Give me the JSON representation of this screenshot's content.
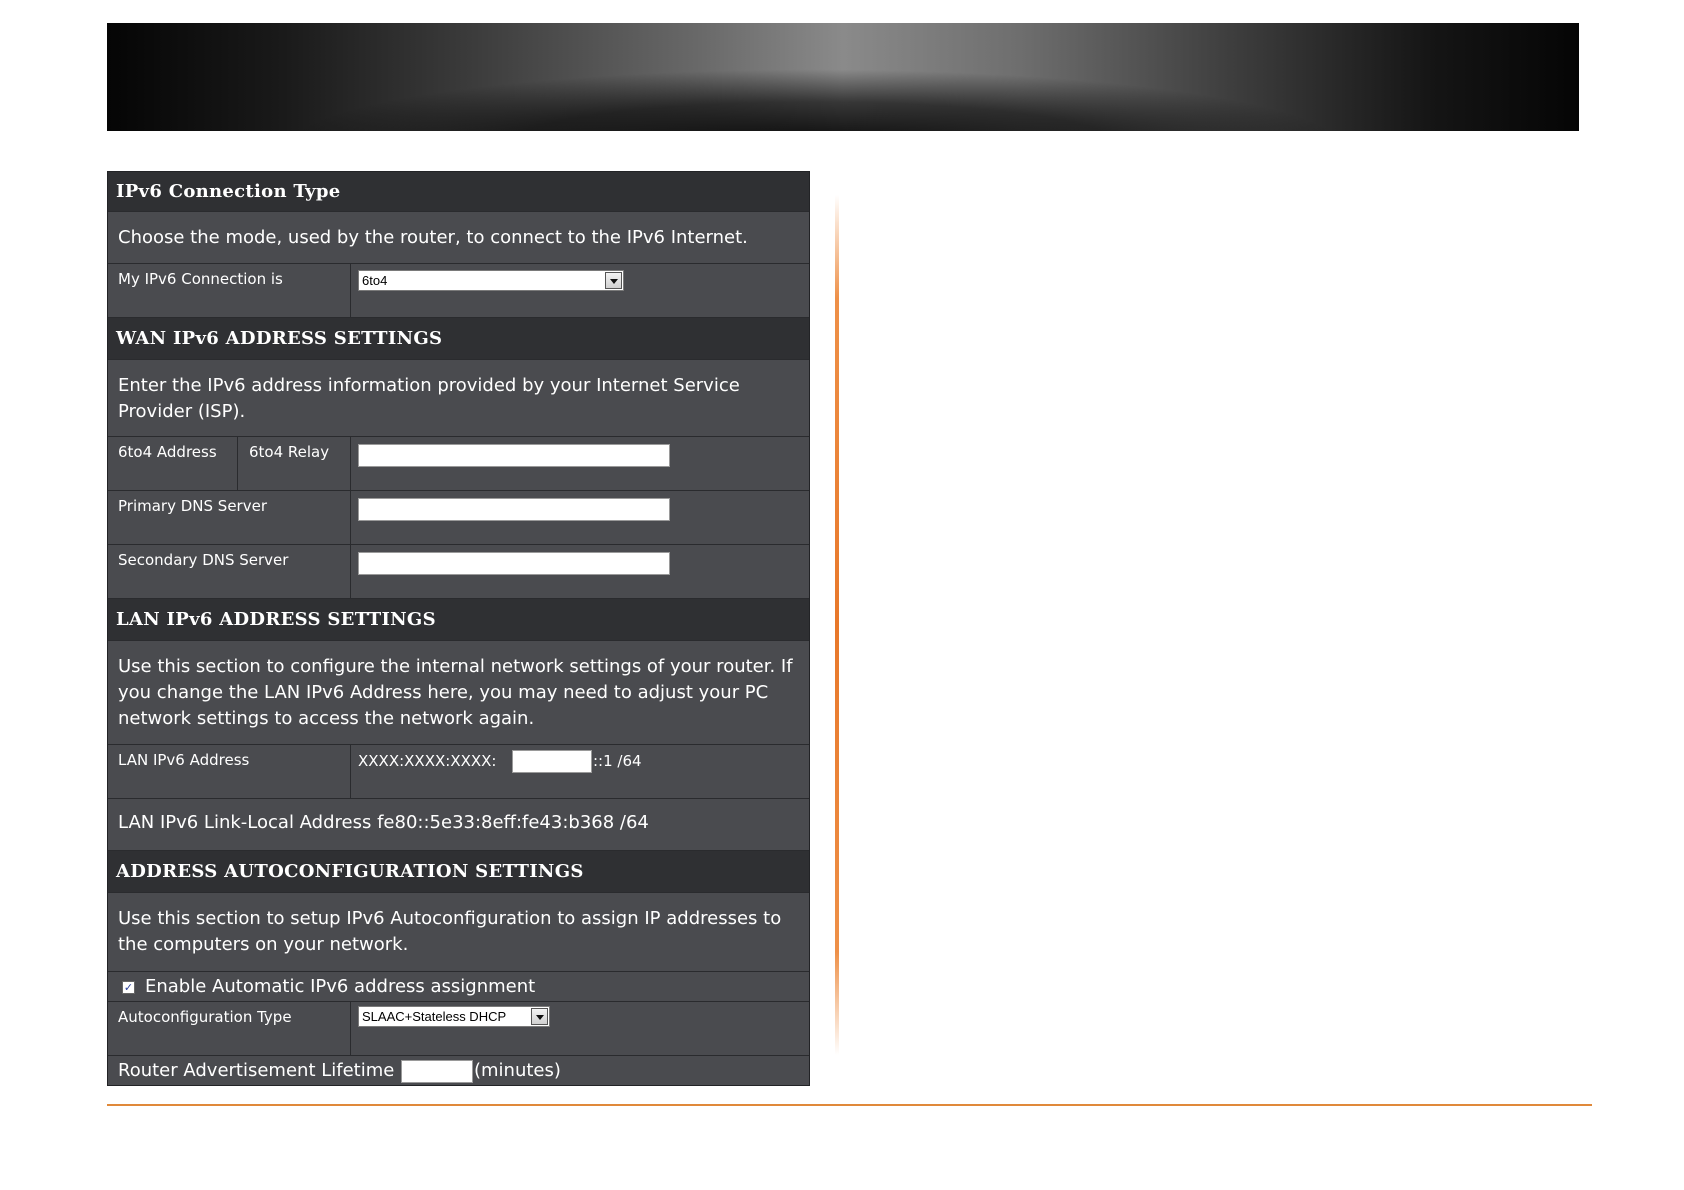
{
  "connection_type": {
    "title": "IPv6 Connection Type",
    "description": "Choose the mode, used by the router, to connect to the IPv6 Internet.",
    "label": "My IPv6 Connection is",
    "selected": "6to4"
  },
  "wan": {
    "title": "WAN IPv6 ADDRESS SETTINGS",
    "description": "Enter the IPv6 address information provided by your Internet Service Provider (ISP).",
    "address_label": "6to4 Address",
    "relay_label": "6to4 Relay",
    "relay_value": "",
    "primary_dns_label": "Primary DNS Server",
    "primary_dns_value": "",
    "secondary_dns_label": "Secondary DNS Server",
    "secondary_dns_value": ""
  },
  "lan": {
    "title": "LAN IPv6 ADDRESS SETTINGS",
    "description": "Use this section to configure the internal network settings of your router. If you change the LAN IPv6 Address here, you may need to adjust your PC network settings to access the network again.",
    "address_label": "LAN IPv6 Address",
    "address_prefix": "XXXX:XXXX:XXXX:",
    "address_value": "",
    "address_suffix": "::1 /64",
    "link_local_label": "LAN IPv6 Link-Local Address",
    "link_local_value": "fe80::5e33:8eff:fe43:b368 /64"
  },
  "autoconf": {
    "title": "ADDRESS AUTOCONFIGURATION SETTINGS",
    "description": "Use this section to setup IPv6 Autoconfiguration to assign IP addresses to the computers on your network.",
    "enable_checked": true,
    "enable_label": "Enable Automatic IPv6 address assignment",
    "type_label": "Autoconfiguration Type",
    "type_selected": "SLAAC+Stateless DHCP",
    "lifetime_label": "Router Advertisement Lifetime",
    "lifetime_value": "",
    "lifetime_unit": "(minutes)"
  },
  "colors": {
    "accent_orange": "#e8782a",
    "panel_bg": "#4a4b4f",
    "header_bg": "#2f3033"
  }
}
